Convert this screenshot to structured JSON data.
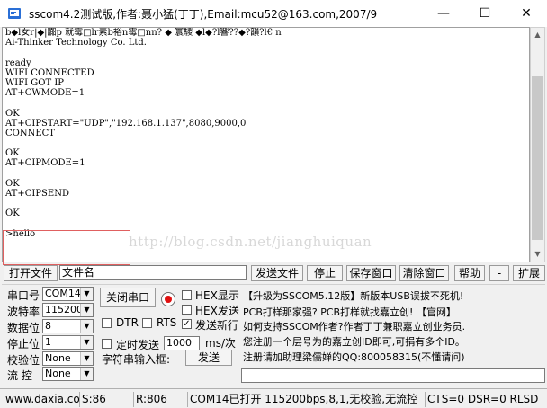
{
  "window": {
    "title": "sscom4.2测试版,作者:聂小猛(丁丁),Email:mcu52@163.com,2007/9",
    "minimize": "—",
    "maximize": "☐",
    "close": "✕"
  },
  "terminal": {
    "lines": [
      "b◆l女r|◆|嚻p 就霉□lr素b裕n霉□nn? ◆ 寰騣 ◆l◆?l響??◆?韻?l€ n",
      "Ai-Thinker Technology Co. Ltd.",
      "",
      "ready",
      "WIFI CONNECTED",
      "WIFI GOT IP",
      "AT+CWMODE=1",
      "",
      "OK",
      "AT+CIPSTART=\"UDP\",\"192.168.1.137\",8080,9000,0",
      "CONNECT",
      "",
      "OK",
      "AT+CIPMODE=1",
      "",
      "OK",
      "AT+CIPSEND",
      "",
      "OK",
      "",
      ">hello"
    ],
    "watermark": "http://blog.csdn.net/jianghuiquan"
  },
  "filebar": {
    "open_file": "打开文件",
    "filename": "文件名",
    "send_file": "发送文件",
    "stop": "停止",
    "save_window": "保存窗口",
    "clear_window": "清除窗口",
    "help": "帮助",
    "dash": "-",
    "expand": "扩展"
  },
  "settings": {
    "port_label": "串口号",
    "port_value": "COM14",
    "baud_label": "波特率",
    "baud_value": "115200",
    "databits_label": "数据位",
    "databits_value": "8",
    "stopbits_label": "停止位",
    "stopbits_value": "1",
    "parity_label": "校验位",
    "parity_value": "None",
    "flow_label": "流  控",
    "flow_value": "None",
    "close_port": "关闭串口",
    "hex_display": "HEX显示",
    "hex_send": "HEX发送",
    "send_newline": "发送新行",
    "dtr": "DTR",
    "rts": "RTS",
    "timed_send": "定时发送",
    "interval": "1000",
    "interval_unit": "ms/次",
    "char_input_label": "字符串输入框:",
    "send": "发送"
  },
  "info": {
    "line1": "【升级为SSCOM5.12版】新版本USB误拔不死机!",
    "line2": "PCB打样那家强? PCB打样就找嘉立创! 【官网】",
    "line3": "如何支持SSCOM作者?作者丁丁兼职嘉立创业务员.",
    "line4": "您注册一个层号为的嘉立创ID即可,可捐有多个ID。",
    "line5": "注册请加助理梁儒婵的QQ:800058315(不懂请问)"
  },
  "status": {
    "site": "www.daxia.com",
    "sent": "S:86",
    "received": "R:806",
    "port_state": "COM14已打开  115200bps,8,1,无校验,无流控",
    "lines": "CTS=0 DSR=0 RLSD"
  }
}
